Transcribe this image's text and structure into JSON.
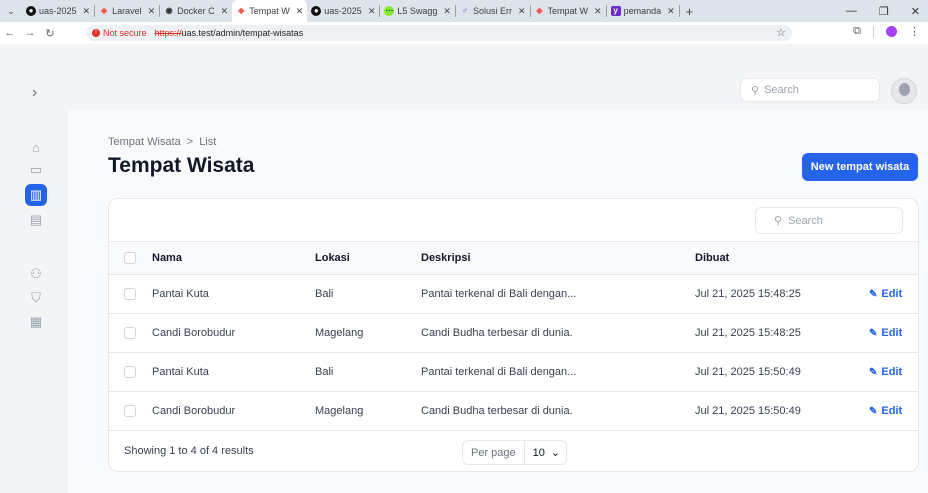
{
  "browser": {
    "tabs": [
      {
        "title": "uas-2025",
        "icon": "github-icon",
        "active": false
      },
      {
        "title": "Laravel",
        "icon": "laravel-icon",
        "active": false
      },
      {
        "title": "Docker C",
        "icon": "docker-icon",
        "active": false
      },
      {
        "title": "Tempat W",
        "icon": "laravel-icon",
        "active": true
      },
      {
        "title": "uas-2025",
        "icon": "github-icon",
        "active": false
      },
      {
        "title": "L5 Swagg",
        "icon": "swagger-icon",
        "active": false
      },
      {
        "title": "Solusi Err",
        "icon": "code-icon",
        "active": false
      },
      {
        "title": "Tempat W",
        "icon": "laravel-icon",
        "active": false
      },
      {
        "title": "pemanda",
        "icon": "bookmark-icon",
        "active": false
      }
    ],
    "security_label": "Not secure",
    "url_scheme": "https://",
    "url_rest": "uas.test/admin/tempat-wisatas"
  },
  "topbar": {
    "search_placeholder": "Search"
  },
  "page": {
    "breadcrumb_parent": "Tempat Wisata",
    "breadcrumb_sep": ">",
    "breadcrumb_current": "List",
    "title": "Tempat Wisata",
    "new_button": "New tempat wisata"
  },
  "table": {
    "search_placeholder": "Search",
    "headers": {
      "nama": "Nama",
      "lokasi": "Lokasi",
      "deskripsi": "Deskripsi",
      "dibuat": "Dibuat"
    },
    "edit_label": "Edit",
    "rows": [
      {
        "nama": "Pantai Kuta",
        "lokasi": "Bali",
        "deskripsi": "Pantai terkenal di Bali dengan...",
        "dibuat": "Jul 21, 2025 15:48:25"
      },
      {
        "nama": "Candi Borobudur",
        "lokasi": "Magelang",
        "deskripsi": "Candi Budha terbesar di dunia.",
        "dibuat": "Jul 21, 2025 15:48:25"
      },
      {
        "nama": "Pantai Kuta",
        "lokasi": "Bali",
        "deskripsi": "Pantai terkenal di Bali dengan...",
        "dibuat": "Jul 21, 2025 15:50:49"
      },
      {
        "nama": "Candi Borobudur",
        "lokasi": "Magelang",
        "deskripsi": "Candi Budha terbesar di dunia.",
        "dibuat": "Jul 21, 2025 15:50:49"
      }
    ],
    "showing": "Showing 1 to 4 of 4 results",
    "per_page_label": "Per page",
    "per_page_value": "10"
  },
  "colors": {
    "accent": "#2563eb",
    "not_secure": "#d93025"
  }
}
